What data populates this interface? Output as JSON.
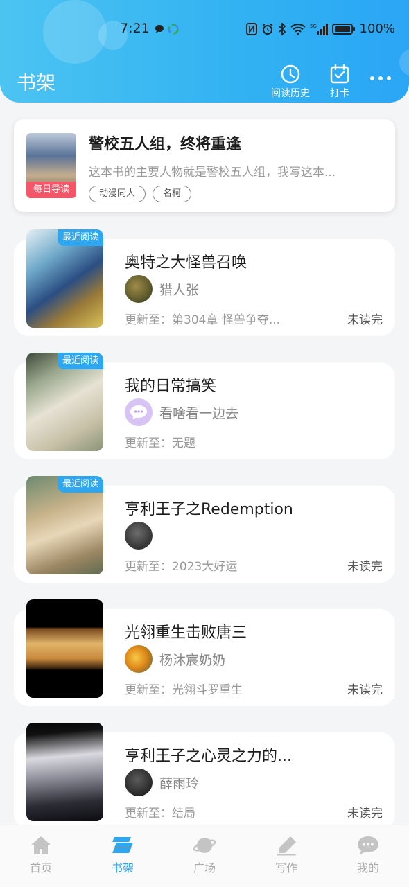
{
  "status_bar": {
    "time": "7:21",
    "battery": "100%",
    "network": "5G"
  },
  "header": {
    "title": "书架",
    "history_label": "阅读历史",
    "checkin_label": "打卡"
  },
  "daily": {
    "badge": "每日导读",
    "title": "警校五人组，终将重逢",
    "desc": "这本书的主要人物就是警校五人组，我写这本...",
    "tags": [
      "动漫同人",
      "名柯"
    ]
  },
  "books": [
    {
      "title": "奥特之大怪兽召唤",
      "author": "猎人张",
      "update": "更新至：第304章 怪兽争夺...",
      "status": "未读完",
      "badge": "最近阅读"
    },
    {
      "title": "我的日常搞笑",
      "author": "看啥看一边去",
      "update": "更新至：无题",
      "status": "",
      "badge": "最近阅读"
    },
    {
      "title": "亨利王子之Redemption",
      "author": "",
      "update": "更新至：2023大好运",
      "status": "未读完",
      "badge": "最近阅读"
    },
    {
      "title": "光翎重生击败唐三",
      "author": "杨沐宸奶奶",
      "update": "更新至：光翎斗罗重生",
      "status": "未读完",
      "badge": ""
    },
    {
      "title": "亨利王子之心灵之力的...",
      "author": "薛雨玲",
      "update": "更新至：结局",
      "status": "未读完",
      "badge": ""
    }
  ],
  "nav": [
    {
      "label": "首页",
      "icon": "home-icon"
    },
    {
      "label": "书架",
      "icon": "bookshelf-icon"
    },
    {
      "label": "广场",
      "icon": "planet-icon"
    },
    {
      "label": "写作",
      "icon": "pen-icon"
    },
    {
      "label": "我的",
      "icon": "chat-bubble-icon"
    }
  ],
  "colors": {
    "accent": "#2ea6f0",
    "header_gradient_start": "#4cc4f2",
    "header_gradient_end": "#2aa6f5",
    "badge_red": "#f4566a"
  }
}
